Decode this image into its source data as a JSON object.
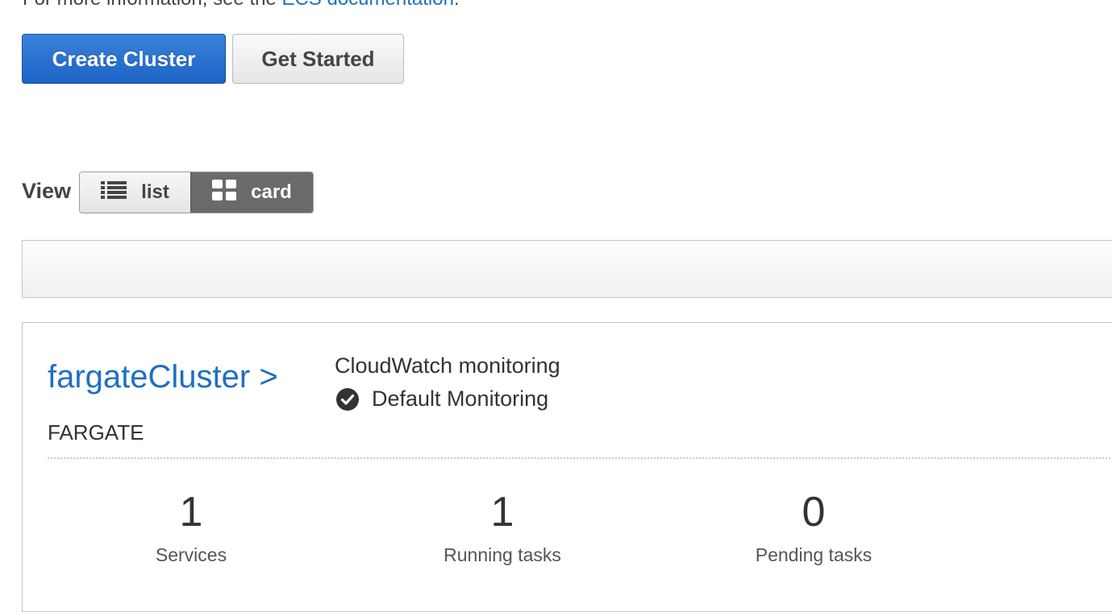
{
  "intro": {
    "prefix": "For more information, see the ",
    "link": "ECS documentation",
    "suffix": "."
  },
  "actions": {
    "create_cluster": "Create Cluster",
    "get_started": "Get Started"
  },
  "view": {
    "label": "View",
    "options": [
      {
        "label": "list",
        "icon": "list-icon",
        "selected": false
      },
      {
        "label": "card",
        "icon": "grid-icon",
        "selected": true
      }
    ]
  },
  "cluster": {
    "name": "fargateCluster >",
    "type": "FARGATE",
    "monitoring_title": "CloudWatch monitoring",
    "monitoring_status": "Default Monitoring",
    "stats": [
      {
        "value": "1",
        "label": "Services"
      },
      {
        "value": "1",
        "label": "Running tasks"
      },
      {
        "value": "0",
        "label": "Pending tasks"
      }
    ]
  },
  "colors": {
    "primary": "#1c63c4",
    "link": "#1e6fc4",
    "selected_toggle": "#6a6a6a"
  }
}
